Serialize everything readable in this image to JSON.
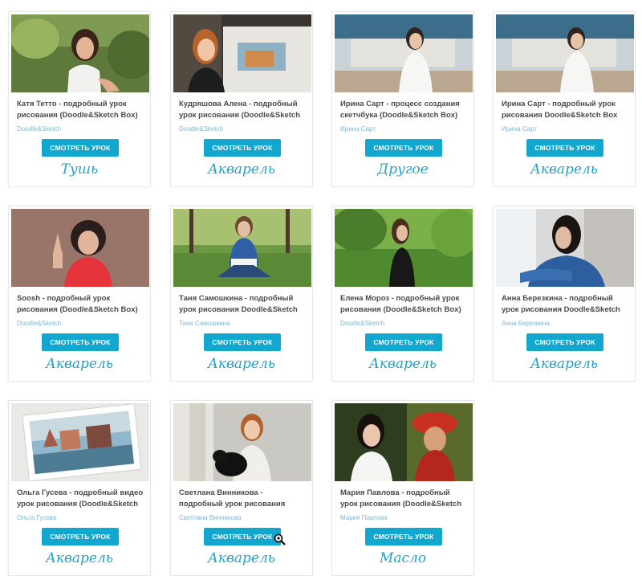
{
  "button_label": "СМОТРЕТЬ УРОК",
  "accent_color": "#12a7cf",
  "cards": [
    {
      "title": "Катя Тетто - подробный урок рисования (Doodle&Sketch Box)",
      "author": "Doodle&Sketch",
      "category": "Тушь"
    },
    {
      "title": "Кудряшова Алена - подробный урок рисования (Doodle&Sketch",
      "author": "Doodle&Sketch",
      "category": "Акварель"
    },
    {
      "title": "Ирина Сарт - процесс создания скетчбука (Doodle&Sketch Box)",
      "author": "Ирина Сарт",
      "category": "Другое"
    },
    {
      "title": "Ирина Сарт - подробный урок рисования Doodle&Sketch Box",
      "author": "Ирина Сарт",
      "category": "Акварель"
    },
    {
      "title": "Soosh - подробный урок рисования (Doodle&Sketch Box)",
      "author": "Doodle&Sketch",
      "category": "Акварель"
    },
    {
      "title": "Таня Самошкина - подробный урок рисования Doodle&Sketch",
      "author": "Таня Самошкина",
      "category": "Акварель"
    },
    {
      "title": "Елена Мороз - подробный урок рисования (Doodle&Sketch Box)",
      "author": "Doodle&Sketch",
      "category": "Акварель"
    },
    {
      "title": "Анна Березкина - подробный урок рисования Doodle&Sketch",
      "author": "Анна Березкина",
      "category": "Акварель"
    },
    {
      "title": "Ольга Гусева - подробный видео урок рисования (Doodle&Sketch",
      "author": "Ольга Гусева",
      "category": "Акварель"
    },
    {
      "title": "Светлана Винникова - подробный урок рисования",
      "author": "Светлана Винникова",
      "category": "Акварель"
    },
    {
      "title": "Мария Павлова - подробный урок рисования (Doodle&Sketch",
      "author": "Мария Павлова",
      "category": "Масло"
    }
  ],
  "cursor_icon": "zoom-in-icon"
}
